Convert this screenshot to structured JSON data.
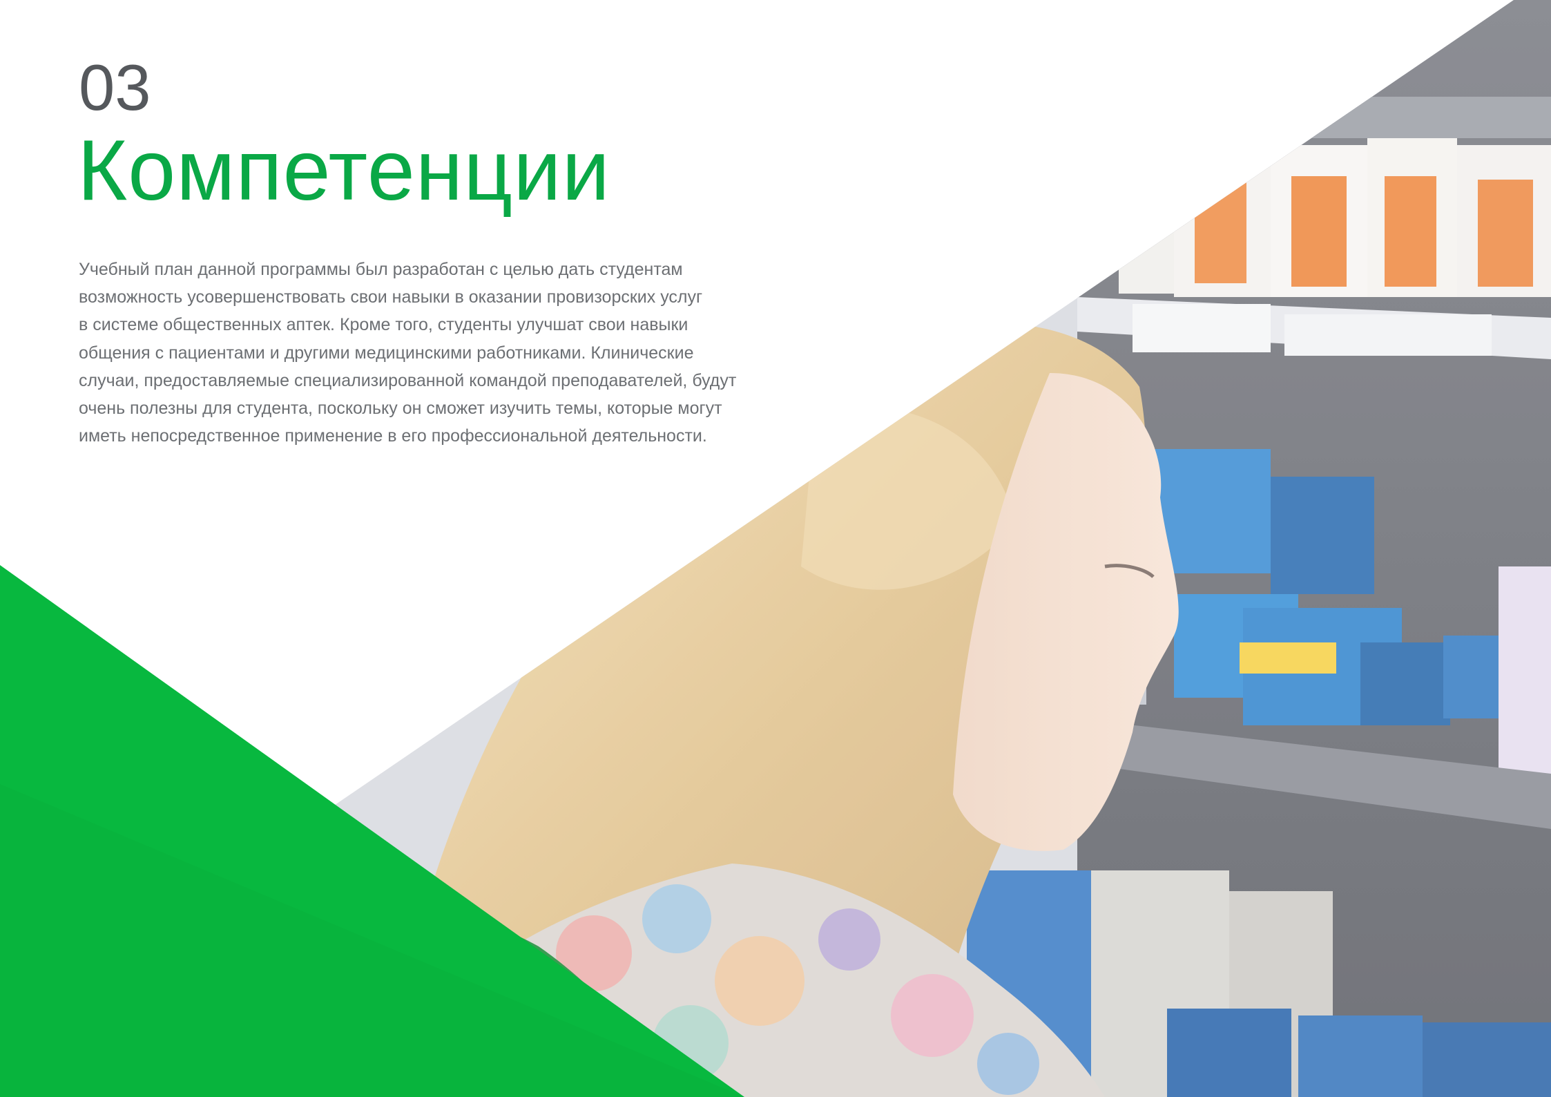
{
  "section": {
    "number": "03",
    "title": "Компетенции"
  },
  "body": {
    "lines": [
      "Учебный план данной программы был разработан с целью дать студентам",
      "возможность усовершенствовать свои навыки в оказании провизорских услуг",
      "в системе общественных аптек. Кроме того, студенты улучшат свои навыки",
      "общения с пациентами и другими медицинскими работниками. Клинические",
      "случаи, предоставляемые специализированной командой преподавателей, будут",
      "очень полезны для студента, поскольку он сможет изучить темы, которые могут",
      "иметь непосредственное применение в его профессиональной деятельности."
    ]
  },
  "colors": {
    "accent_green": "#0aa846",
    "triangle_green": "#08b83f",
    "number_gray": "#55585c",
    "text_gray": "#6c6f73"
  }
}
